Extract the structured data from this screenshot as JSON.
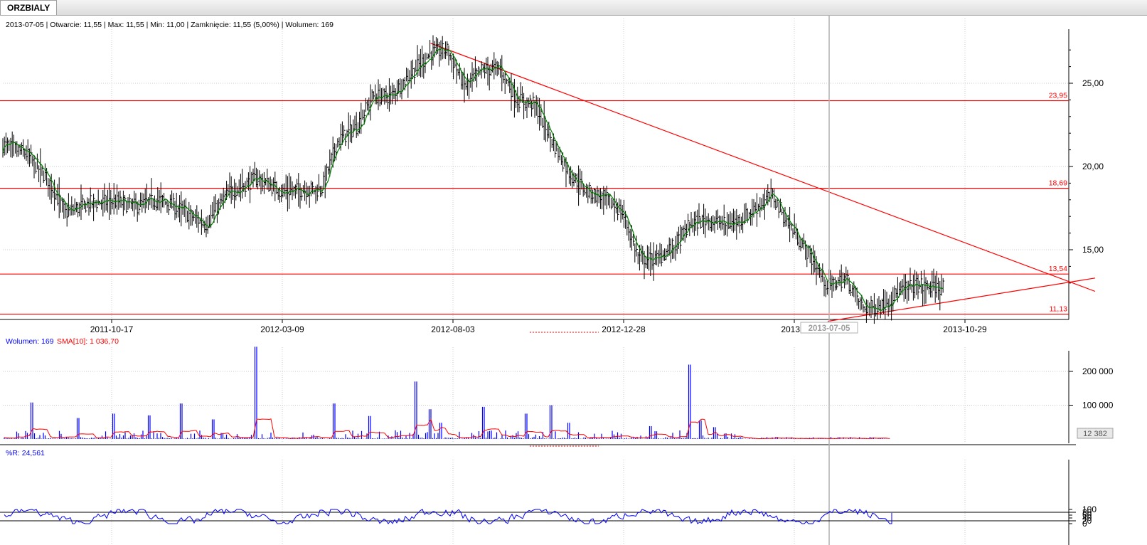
{
  "tab": {
    "label": "ORZBIALY"
  },
  "header": {
    "info": "2013-07-05 | Otwarcie: 11,55 | Max: 11,55 | Min: 11,00 | Zamknięcie: 11,55 (5,00%) | Wolumen: 169"
  },
  "volume_panel": {
    "label_volume": "Wolumen: 169",
    "label_sma": "SMA[10]: 1 036,70",
    "current_value": "12 382"
  },
  "wr_panel": {
    "label": "%R: 24,561"
  },
  "crosshair": {
    "date_label": "2013-07-05"
  },
  "colors": {
    "candles": "#000000",
    "sma_line": "#008000",
    "levels": "#ff0000",
    "volume_bars": "#0000ff",
    "volume_sma": "#ff0000",
    "wr_line": "#0000ff"
  },
  "chart_data": [
    {
      "type": "ohlc",
      "title": "ORZBIALY",
      "x_ticks": [
        "2011-10-17",
        "2012-03-09",
        "2012-08-03",
        "2012-12-28",
        "2013-0",
        "2013-10-29"
      ],
      "y_ticks": [
        "15,00",
        "20,00",
        "25,00"
      ],
      "ylim": [
        10.5,
        27.5
      ],
      "grid": true,
      "last_bar": {
        "date": "2013-07-05",
        "open": 11.55,
        "high": 11.55,
        "low": 11.0,
        "close": 11.55,
        "change": "5,00%",
        "volume": 169
      },
      "close_series_approx": [
        [
          "2011-05-26",
          21.3
        ],
        [
          "2011-06-15",
          20.8
        ],
        [
          "2011-07-05",
          19.2
        ],
        [
          "2011-07-20",
          17.2
        ],
        [
          "2011-08-10",
          17.8
        ],
        [
          "2011-09-01",
          17.9
        ],
        [
          "2011-09-20",
          17.6
        ],
        [
          "2011-10-10",
          18.0
        ],
        [
          "2011-10-30",
          17.4
        ],
        [
          "2011-11-20",
          16.5
        ],
        [
          "2011-12-10",
          18.4
        ],
        [
          "2012-01-05",
          19.3
        ],
        [
          "2012-01-25",
          18.5
        ],
        [
          "2012-02-15",
          18.6
        ],
        [
          "2012-03-01",
          18.6
        ],
        [
          "2012-03-15",
          21.5
        ],
        [
          "2012-04-01",
          22.4
        ],
        [
          "2012-04-15",
          24.2
        ],
        [
          "2012-05-01",
          24.2
        ],
        [
          "2012-05-20",
          25.7
        ],
        [
          "2012-06-05",
          26.8
        ],
        [
          "2012-06-20",
          27.0
        ],
        [
          "2012-07-05",
          24.8
        ],
        [
          "2012-07-20",
          25.8
        ],
        [
          "2012-08-05",
          25.9
        ],
        [
          "2012-08-20",
          24.0
        ],
        [
          "2012-09-05",
          23.7
        ],
        [
          "2012-09-20",
          21.5
        ],
        [
          "2012-10-05",
          19.6
        ],
        [
          "2012-10-20",
          18.5
        ],
        [
          "2012-11-05",
          18.1
        ],
        [
          "2012-11-20",
          17.3
        ],
        [
          "2012-12-05",
          14.5
        ],
        [
          "2012-12-20",
          14.4
        ],
        [
          "2013-01-05",
          15.2
        ],
        [
          "2013-01-20",
          16.6
        ],
        [
          "2013-02-05",
          16.8
        ],
        [
          "2013-02-20",
          16.5
        ],
        [
          "2013-03-05",
          16.8
        ],
        [
          "2013-03-20",
          17.6
        ],
        [
          "2013-04-01",
          18.3
        ],
        [
          "2013-04-15",
          16.6
        ],
        [
          "2013-05-01",
          15.0
        ],
        [
          "2013-05-20",
          12.8
        ],
        [
          "2013-06-05",
          13.3
        ],
        [
          "2013-06-20",
          11.5
        ],
        [
          "2013-07-05",
          11.55
        ],
        [
          "2013-07-20",
          12.4
        ],
        [
          "2013-08-05",
          12.9
        ],
        [
          "2013-08-20",
          12.7
        ],
        [
          "2013-08-30",
          12.8
        ]
      ],
      "overlays": {
        "horizontal_levels": [
          {
            "value": 23.95,
            "label": "23,95"
          },
          {
            "value": 18.69,
            "label": "18,69"
          },
          {
            "value": 13.54,
            "label": "13,54"
          },
          {
            "value": 11.13,
            "label": "11,13"
          }
        ],
        "trendlines": [
          {
            "from": [
              "2012-06-05",
              27.4
            ],
            "to": [
              "2014-01-10",
              12.5
            ]
          },
          {
            "from": [
              "2013-05-20",
              10.7
            ],
            "to": [
              "2014-01-10",
              13.3
            ]
          }
        ]
      }
    },
    {
      "type": "bar",
      "name": "Wolumen",
      "y_ticks": [
        "100 000",
        "200 000"
      ],
      "ylim": [
        0,
        275000
      ],
      "last_value": 169,
      "sma_label": "SMA[10]",
      "sma_last": 1036.7
    },
    {
      "type": "line",
      "name": "%R",
      "y_ticks": [
        "0",
        "20",
        "40",
        "60",
        "80",
        "100"
      ],
      "ylim": [
        0,
        100
      ],
      "bands": [
        20,
        80
      ],
      "last_value": 24.561
    }
  ]
}
